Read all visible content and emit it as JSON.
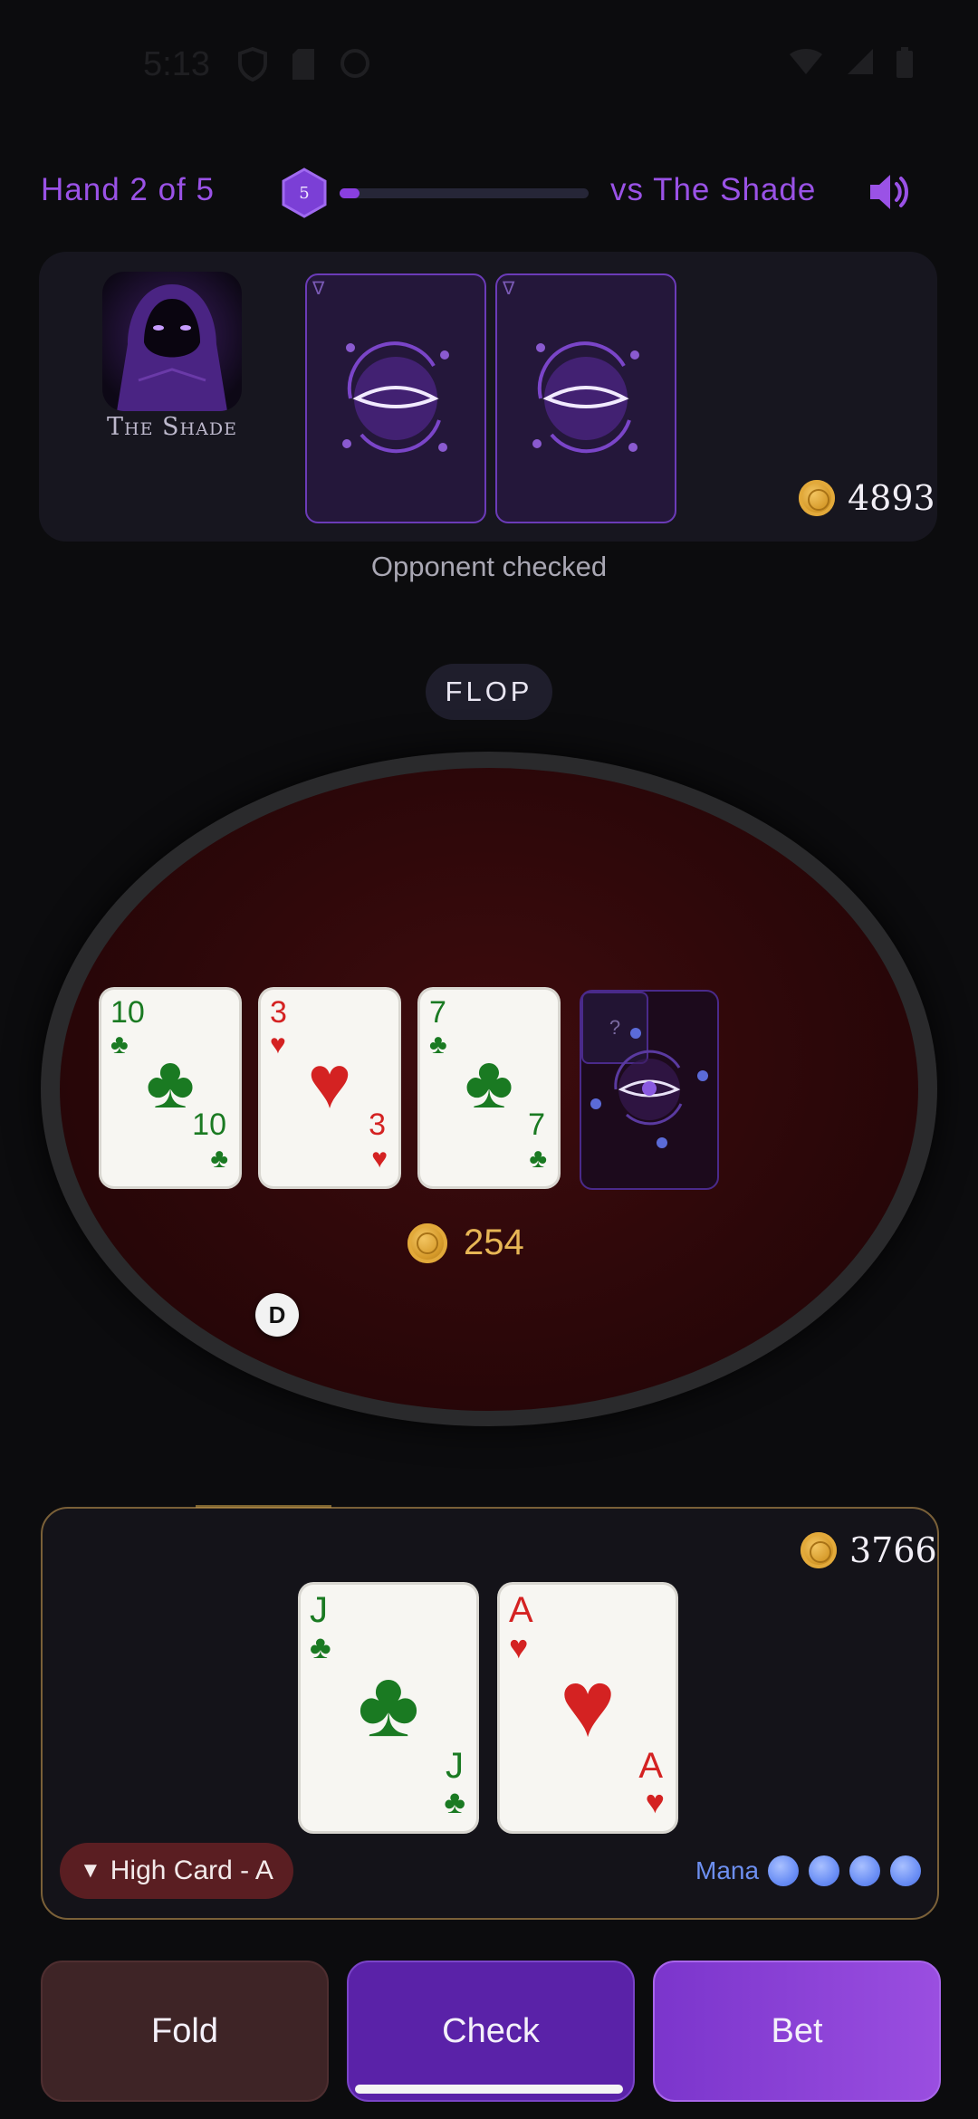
{
  "status_bar": {
    "time": "5:13"
  },
  "top_bar": {
    "hand_label": "Hand 2 of 5",
    "level": "5",
    "progress_fraction": 0.08,
    "vs_label": "vs The Shade"
  },
  "opponent": {
    "name": "The Shade",
    "chips": "4893",
    "card_corner": "∇",
    "status": "Opponent checked"
  },
  "stage": "FLOP",
  "board": {
    "cards": [
      {
        "rank": "10",
        "suit": "♣",
        "color": "green"
      },
      {
        "rank": "3",
        "suit": "♥",
        "color": "red"
      },
      {
        "rank": "7",
        "suit": "♣",
        "color": "green"
      }
    ],
    "mystery_label": "?"
  },
  "pot": "254",
  "dealer_button": "D",
  "player": {
    "chips": "3766",
    "cards": [
      {
        "rank": "J",
        "suit": "♣",
        "color": "green"
      },
      {
        "rank": "A",
        "suit": "♥",
        "color": "red"
      }
    ],
    "hand_rank": "High Card - A",
    "hand_rank_arrow": "▼",
    "mana_label": "Mana",
    "mana_count": 4
  },
  "actions": {
    "fold": "Fold",
    "check": "Check",
    "bet": "Bet"
  },
  "colors": {
    "accent": "#9a52e6",
    "felt": "#2c0709",
    "gold": "#e7b655",
    "mana": "#6d8ff0"
  }
}
